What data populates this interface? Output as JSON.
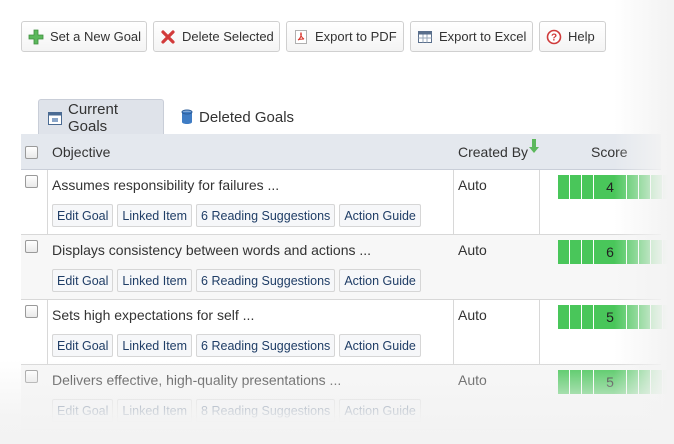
{
  "toolbar": {
    "new_goal": "Set a New Goal",
    "delete_selected": "Delete Selected",
    "export_pdf": "Export to PDF",
    "export_excel": "Export to Excel",
    "help": "Help"
  },
  "tabs": [
    {
      "label": "Current Goals",
      "active": true
    },
    {
      "label": "Deleted Goals",
      "active": false
    }
  ],
  "columns": {
    "objective": "Objective",
    "created_by": "Created By",
    "score": "Score"
  },
  "rows": [
    {
      "objective": "Assumes responsibility for failures ...",
      "created_by": "Auto",
      "score": "4",
      "links": [
        "Edit Goal",
        "Linked Item",
        "6 Reading Suggestions",
        "Action Guide"
      ]
    },
    {
      "objective": "Displays consistency between words and actions ...",
      "created_by": "Auto",
      "score": "6",
      "links": [
        "Edit Goal",
        "Linked Item",
        "6 Reading Suggestions",
        "Action Guide"
      ]
    },
    {
      "objective": "Sets high expectations for self ...",
      "created_by": "Auto",
      "score": "5",
      "links": [
        "Edit Goal",
        "Linked Item",
        "6 Reading Suggestions",
        "Action Guide"
      ]
    },
    {
      "objective": "Delivers effective, high-quality presentations ...",
      "created_by": "Auto",
      "score": "5",
      "links": [
        "Edit Goal",
        "Linked Item",
        "8 Reading Suggestions",
        "Action Guide"
      ]
    }
  ],
  "colors": {
    "score_green": "#49c65a",
    "header_bg": "#e4e8ee",
    "link_text": "#1f3d66"
  }
}
